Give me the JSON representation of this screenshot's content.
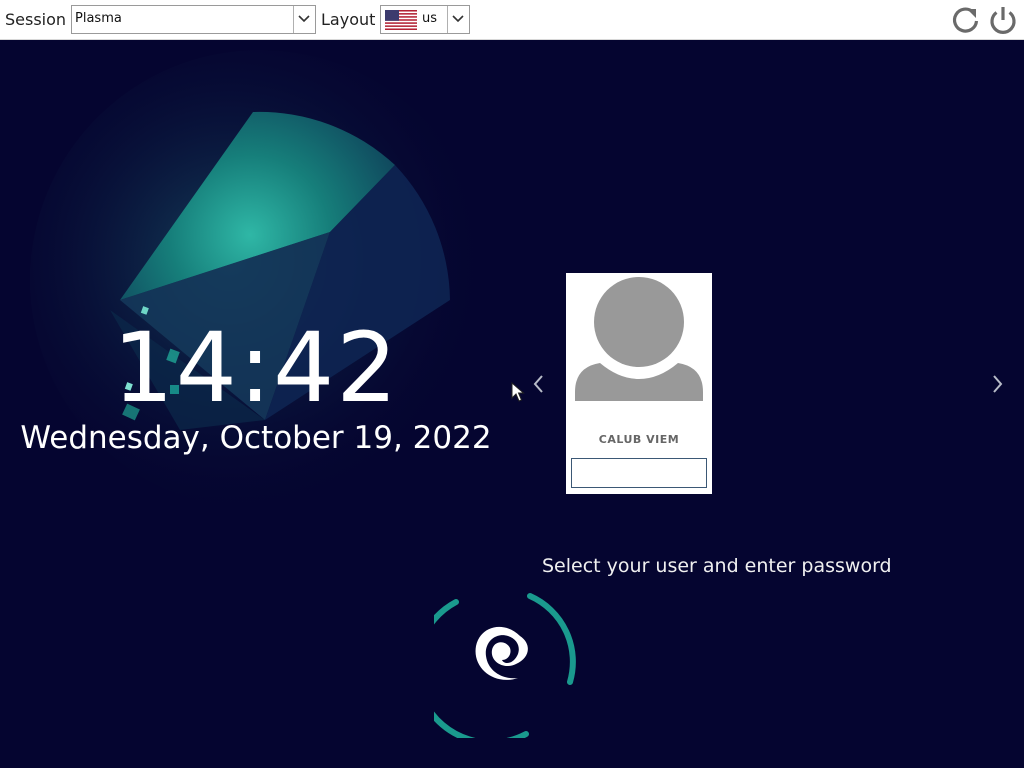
{
  "topbar": {
    "session_label": "Session",
    "session_value": "Plasma",
    "layout_label": "Layout",
    "layout_value": "us",
    "layout_flag_icon": "us-flag-icon",
    "reboot_icon": "reboot-icon",
    "shutdown_icon": "power-icon"
  },
  "clock": {
    "time": "14:42",
    "date": "Wednesday, October 19, 2022"
  },
  "user_card": {
    "name": "CALUB VIEM",
    "avatar_icon": "user-avatar-icon",
    "password_value": ""
  },
  "navigation": {
    "prev_icon": "chevron-left-icon",
    "next_icon": "chevron-right-icon"
  },
  "prompt": "Select your user and enter password",
  "colors": {
    "background": "#050530",
    "accent": "#1a9a8e",
    "text": "#ffffff"
  }
}
